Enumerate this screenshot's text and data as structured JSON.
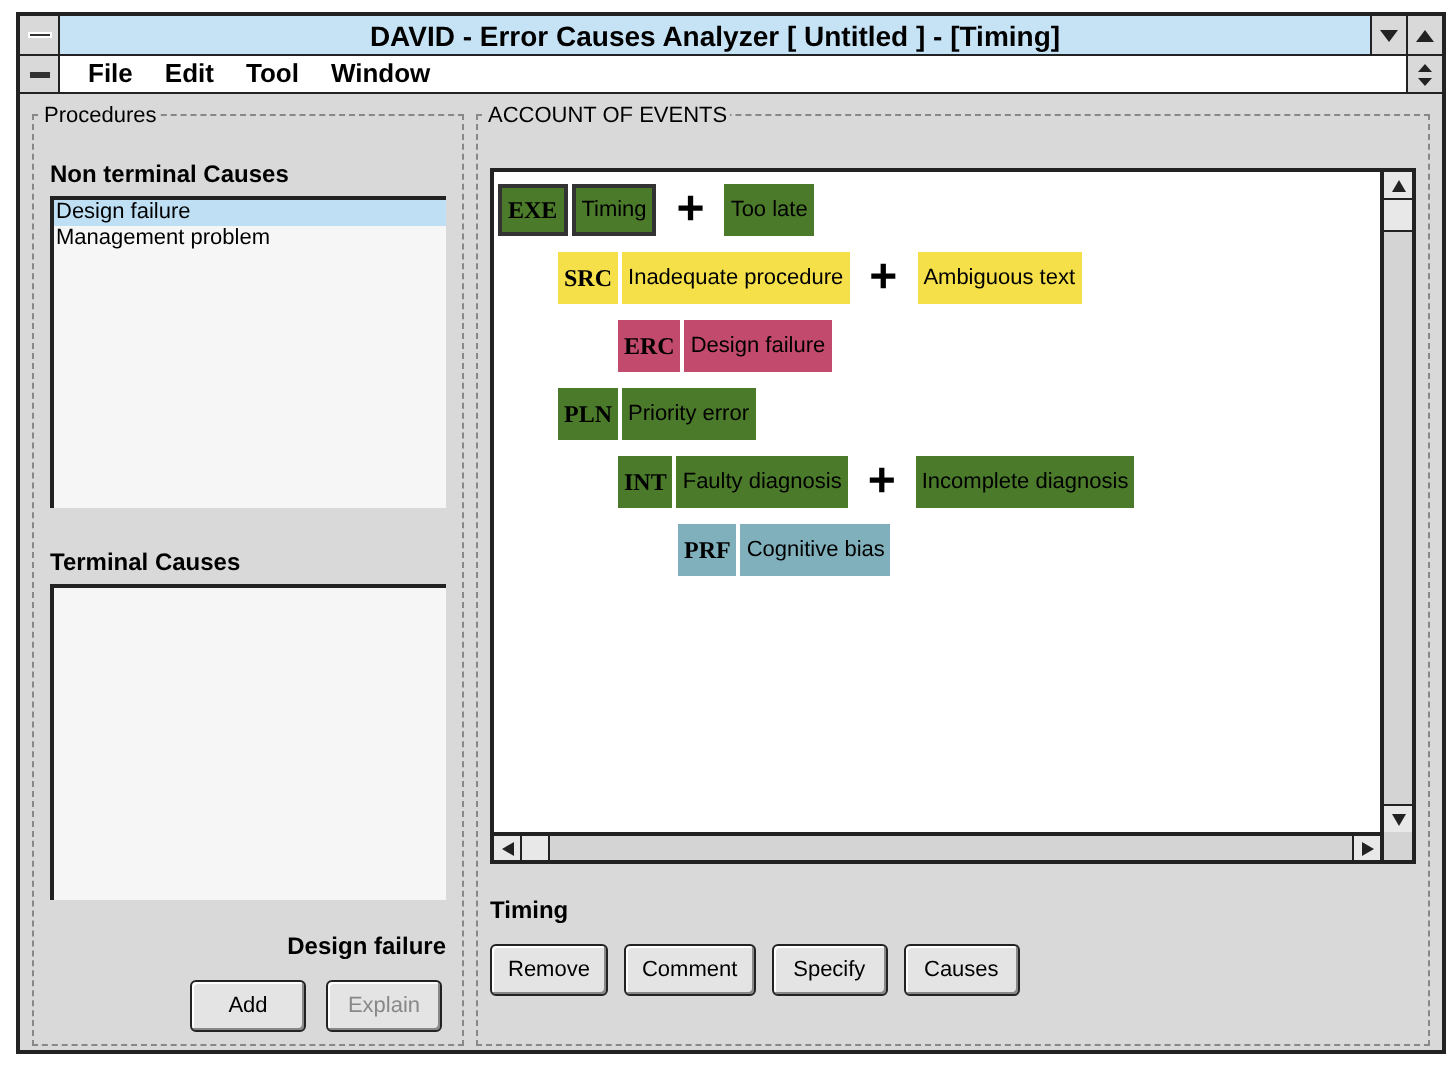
{
  "window": {
    "title": "DAVID - Error Causes Analyzer [ Untitled ]  - [Timing]"
  },
  "menu": [
    "File",
    "Edit",
    "Tool",
    "Window"
  ],
  "procedures": {
    "title": "Procedures",
    "non_terminal": {
      "label": "Non terminal Causes",
      "items": [
        {
          "text": "Design failure",
          "selected": true
        },
        {
          "text": "Management problem",
          "selected": false
        }
      ]
    },
    "terminal": {
      "label": "Terminal Causes"
    },
    "current": "Design failure",
    "buttons": [
      {
        "label": "Add",
        "disabled": false
      },
      {
        "label": "Explain",
        "disabled": true
      }
    ]
  },
  "events": {
    "title": "ACCOUNT OF EVENTS",
    "tree": [
      {
        "code": "EXE",
        "label": "Timing",
        "color": "#4a7a2a",
        "selected": true,
        "joiner": "+",
        "second": "Too late",
        "children": [
          {
            "code": "SRC",
            "label": "Inadequate procedure",
            "color": "#f5e04a",
            "selected": false,
            "joiner": "+",
            "second": "Ambiguous text",
            "children": [
              {
                "code": "ERC",
                "label": "Design failure",
                "color": "#c24a6c",
                "selected": false
              }
            ]
          },
          {
            "code": "PLN",
            "label": "Priority error",
            "color": "#4a7a2a",
            "selected": false,
            "children": [
              {
                "code": "INT",
                "label": "Faulty diagnosis",
                "color": "#4a7a2a",
                "selected": false,
                "joiner": "+",
                "second": "Incomplete diagnosis",
                "children": [
                  {
                    "code": "PRF",
                    "label": "Cognitive bias",
                    "color": "#7fb0bc",
                    "selected": false
                  }
                ]
              }
            ]
          }
        ]
      }
    ],
    "current": "Timing",
    "buttons": [
      {
        "label": "Remove",
        "disabled": false
      },
      {
        "label": "Comment",
        "disabled": false
      },
      {
        "label": "Specify",
        "disabled": false
      },
      {
        "label": "Causes",
        "disabled": false
      }
    ]
  }
}
